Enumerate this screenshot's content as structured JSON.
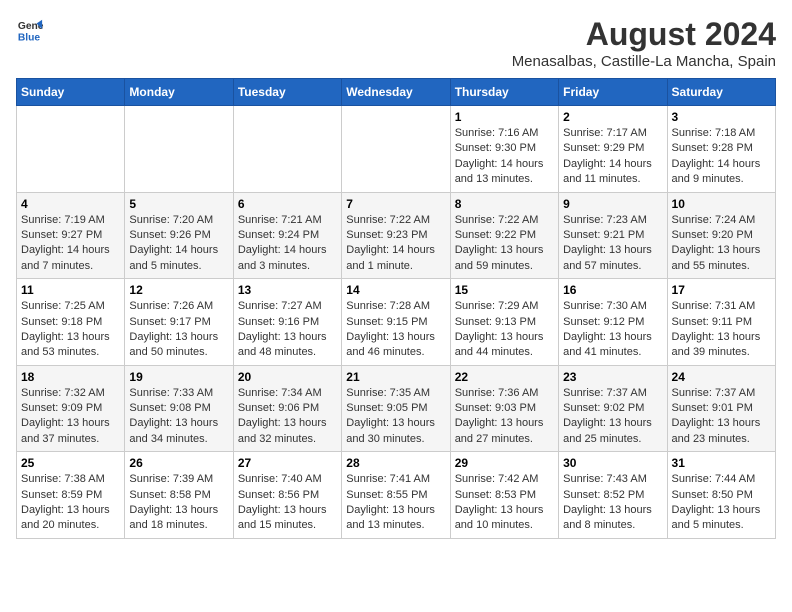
{
  "app": {
    "logo_line1": "General",
    "logo_line2": "Blue"
  },
  "title": "August 2024",
  "subtitle": "Menasalbas, Castille-La Mancha, Spain",
  "headers": [
    "Sunday",
    "Monday",
    "Tuesday",
    "Wednesday",
    "Thursday",
    "Friday",
    "Saturday"
  ],
  "weeks": [
    [
      {
        "day": "",
        "info": ""
      },
      {
        "day": "",
        "info": ""
      },
      {
        "day": "",
        "info": ""
      },
      {
        "day": "",
        "info": ""
      },
      {
        "day": "1",
        "info": "Sunrise: 7:16 AM\nSunset: 9:30 PM\nDaylight: 14 hours\nand 13 minutes."
      },
      {
        "day": "2",
        "info": "Sunrise: 7:17 AM\nSunset: 9:29 PM\nDaylight: 14 hours\nand 11 minutes."
      },
      {
        "day": "3",
        "info": "Sunrise: 7:18 AM\nSunset: 9:28 PM\nDaylight: 14 hours\nand 9 minutes."
      }
    ],
    [
      {
        "day": "4",
        "info": "Sunrise: 7:19 AM\nSunset: 9:27 PM\nDaylight: 14 hours\nand 7 minutes."
      },
      {
        "day": "5",
        "info": "Sunrise: 7:20 AM\nSunset: 9:26 PM\nDaylight: 14 hours\nand 5 minutes."
      },
      {
        "day": "6",
        "info": "Sunrise: 7:21 AM\nSunset: 9:24 PM\nDaylight: 14 hours\nand 3 minutes."
      },
      {
        "day": "7",
        "info": "Sunrise: 7:22 AM\nSunset: 9:23 PM\nDaylight: 14 hours\nand 1 minute."
      },
      {
        "day": "8",
        "info": "Sunrise: 7:22 AM\nSunset: 9:22 PM\nDaylight: 13 hours\nand 59 minutes."
      },
      {
        "day": "9",
        "info": "Sunrise: 7:23 AM\nSunset: 9:21 PM\nDaylight: 13 hours\nand 57 minutes."
      },
      {
        "day": "10",
        "info": "Sunrise: 7:24 AM\nSunset: 9:20 PM\nDaylight: 13 hours\nand 55 minutes."
      }
    ],
    [
      {
        "day": "11",
        "info": "Sunrise: 7:25 AM\nSunset: 9:18 PM\nDaylight: 13 hours\nand 53 minutes."
      },
      {
        "day": "12",
        "info": "Sunrise: 7:26 AM\nSunset: 9:17 PM\nDaylight: 13 hours\nand 50 minutes."
      },
      {
        "day": "13",
        "info": "Sunrise: 7:27 AM\nSunset: 9:16 PM\nDaylight: 13 hours\nand 48 minutes."
      },
      {
        "day": "14",
        "info": "Sunrise: 7:28 AM\nSunset: 9:15 PM\nDaylight: 13 hours\nand 46 minutes."
      },
      {
        "day": "15",
        "info": "Sunrise: 7:29 AM\nSunset: 9:13 PM\nDaylight: 13 hours\nand 44 minutes."
      },
      {
        "day": "16",
        "info": "Sunrise: 7:30 AM\nSunset: 9:12 PM\nDaylight: 13 hours\nand 41 minutes."
      },
      {
        "day": "17",
        "info": "Sunrise: 7:31 AM\nSunset: 9:11 PM\nDaylight: 13 hours\nand 39 minutes."
      }
    ],
    [
      {
        "day": "18",
        "info": "Sunrise: 7:32 AM\nSunset: 9:09 PM\nDaylight: 13 hours\nand 37 minutes."
      },
      {
        "day": "19",
        "info": "Sunrise: 7:33 AM\nSunset: 9:08 PM\nDaylight: 13 hours\nand 34 minutes."
      },
      {
        "day": "20",
        "info": "Sunrise: 7:34 AM\nSunset: 9:06 PM\nDaylight: 13 hours\nand 32 minutes."
      },
      {
        "day": "21",
        "info": "Sunrise: 7:35 AM\nSunset: 9:05 PM\nDaylight: 13 hours\nand 30 minutes."
      },
      {
        "day": "22",
        "info": "Sunrise: 7:36 AM\nSunset: 9:03 PM\nDaylight: 13 hours\nand 27 minutes."
      },
      {
        "day": "23",
        "info": "Sunrise: 7:37 AM\nSunset: 9:02 PM\nDaylight: 13 hours\nand 25 minutes."
      },
      {
        "day": "24",
        "info": "Sunrise: 7:37 AM\nSunset: 9:01 PM\nDaylight: 13 hours\nand 23 minutes."
      }
    ],
    [
      {
        "day": "25",
        "info": "Sunrise: 7:38 AM\nSunset: 8:59 PM\nDaylight: 13 hours\nand 20 minutes."
      },
      {
        "day": "26",
        "info": "Sunrise: 7:39 AM\nSunset: 8:58 PM\nDaylight: 13 hours\nand 18 minutes."
      },
      {
        "day": "27",
        "info": "Sunrise: 7:40 AM\nSunset: 8:56 PM\nDaylight: 13 hours\nand 15 minutes."
      },
      {
        "day": "28",
        "info": "Sunrise: 7:41 AM\nSunset: 8:55 PM\nDaylight: 13 hours\nand 13 minutes."
      },
      {
        "day": "29",
        "info": "Sunrise: 7:42 AM\nSunset: 8:53 PM\nDaylight: 13 hours\nand 10 minutes."
      },
      {
        "day": "30",
        "info": "Sunrise: 7:43 AM\nSunset: 8:52 PM\nDaylight: 13 hours\nand 8 minutes."
      },
      {
        "day": "31",
        "info": "Sunrise: 7:44 AM\nSunset: 8:50 PM\nDaylight: 13 hours\nand 5 minutes."
      }
    ]
  ]
}
